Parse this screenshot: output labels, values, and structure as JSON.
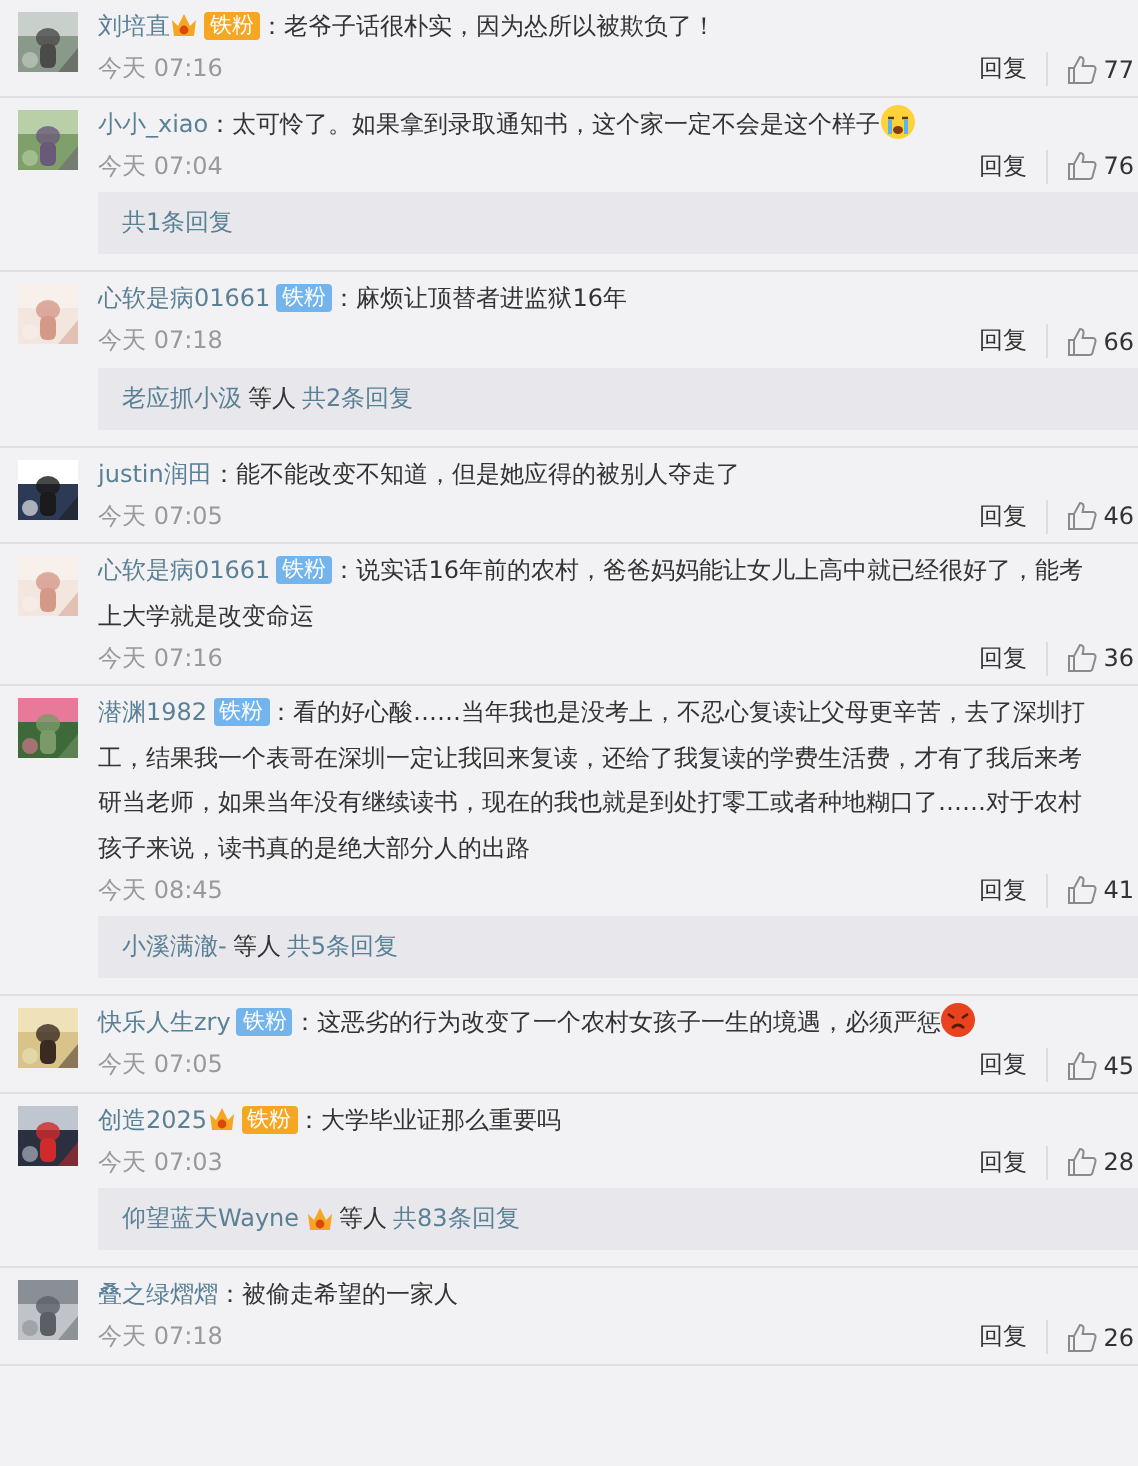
{
  "comments": [
    {
      "user": "刘培直",
      "badge": {
        "text": "铁粉",
        "kind": "gold"
      },
      "text": "：老爷子话很朴实，因为怂所以被欺负了！",
      "time": "今天 07:16",
      "reply": "回复",
      "likes": "77"
    },
    {
      "user": "小小_xiao",
      "text": "：太可怜了。如果拿到录取通知书，这个家一定不会是这个样子",
      "emoji": {
        "kind": "crying"
      },
      "time": "今天 07:04",
      "reply": "回复",
      "likes": "76",
      "replies": {
        "total": "共1条回复"
      }
    },
    {
      "user": "心软是病01661",
      "badge": {
        "text": "铁粉",
        "kind": "blue"
      },
      "text": "：麻烦让顶替者进监狱16年",
      "time": "今天 07:18",
      "reply": "回复",
      "likes": "66",
      "replies": {
        "user": "老应抓小汲",
        "vip": false,
        "others": "等人",
        "total": "共2条回复"
      }
    },
    {
      "user": "justin润田",
      "text": "：能不能改变不知道，但是她应得的被别人夺走了",
      "time": "今天 07:05",
      "reply": "回复",
      "likes": "46"
    },
    {
      "user": "心软是病01661",
      "badge": {
        "text": "铁粉",
        "kind": "blue"
      },
      "text": "：说实话16年前的农村，爸爸妈妈能让女儿上高中就已经很好了，能考上大学就是改变命运",
      "time": "今天 07:16",
      "reply": "回复",
      "likes": "36"
    },
    {
      "user": "潜渊1982",
      "badge": {
        "text": "铁粉",
        "kind": "blue"
      },
      "text": "：看的好心酸……当年我也是没考上，不忍心复读让父母更辛苦，去了深圳打工，结果我一个表哥在深圳一定让我回来复读，还给了我复读的学费生活费，才有了我后来考研当老师，如果当年没有继续读书，现在的我也就是到处打零工或者种地糊口了……对于农村孩子来说，读书真的是绝大部分人的出路",
      "time": "今天 08:45",
      "reply": "回复",
      "likes": "41",
      "replies": {
        "user": "小溪满澈-",
        "vip": false,
        "others": "等人",
        "total": "共5条回复"
      }
    },
    {
      "user": "快乐人生zry",
      "badge": {
        "text": "铁粉",
        "kind": "blue"
      },
      "text": "：这恶劣的行为改变了一个农村女孩子一生的境遇，必须严惩",
      "emoji": {
        "kind": "angry"
      },
      "time": "今天 07:05",
      "reply": "回复",
      "likes": "45"
    },
    {
      "user": "创造2025",
      "badge": {
        "text": "铁粉",
        "kind": "gold"
      },
      "text": "：大学毕业证那么重要吗",
      "time": "今天 07:03",
      "reply": "回复",
      "likes": "28",
      "replies": {
        "user": "仰望蓝天Wayne",
        "vip": true,
        "others": "等人",
        "total": "共83条回复"
      }
    },
    {
      "user": "叠之绿熠熠",
      "text": "：被偷走希望的一家人",
      "time": "今天 07:18",
      "reply": "回复",
      "likes": "26"
    }
  ]
}
